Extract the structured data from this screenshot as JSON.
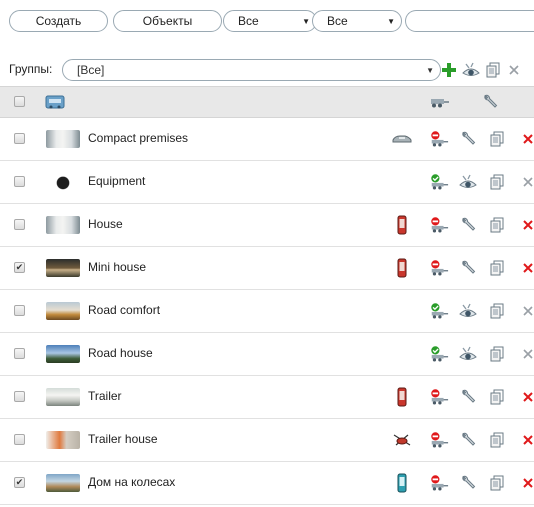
{
  "toolbar": {
    "create_label": "Создать",
    "objects_label": "Объекты",
    "filter1_value": "Все",
    "filter2_value": "Все",
    "search_value": ""
  },
  "groups": {
    "label": "Группы:",
    "selected": "[Все]"
  },
  "rows": [
    {
      "name": "Compact premises",
      "checked": false,
      "device": "car-icon",
      "status": "red",
      "action": "wrench-icon",
      "deletable": true
    },
    {
      "name": "Equipment",
      "checked": false,
      "device": "",
      "status": "green",
      "action": "eye-icon",
      "deletable": false
    },
    {
      "name": "House",
      "checked": false,
      "device": "phone-red-icon",
      "status": "red",
      "action": "wrench-icon",
      "deletable": true
    },
    {
      "name": "Mini house",
      "checked": true,
      "device": "phone-red-icon",
      "status": "red",
      "action": "wrench-icon",
      "deletable": true
    },
    {
      "name": "Road comfort",
      "checked": false,
      "device": "",
      "status": "green",
      "action": "eye-icon",
      "deletable": false
    },
    {
      "name": "Road house",
      "checked": false,
      "device": "",
      "status": "green",
      "action": "eye-icon",
      "deletable": false
    },
    {
      "name": "Trailer",
      "checked": false,
      "device": "phone-red-icon",
      "status": "red",
      "action": "wrench-icon",
      "deletable": true
    },
    {
      "name": "Trailer house",
      "checked": false,
      "device": "helicopter-icon",
      "status": "red",
      "action": "wrench-icon",
      "deletable": true
    },
    {
      "name": "Дом на колесах",
      "checked": true,
      "device": "phone-teal-icon",
      "status": "red",
      "action": "wrench-icon",
      "deletable": true
    }
  ],
  "colors": {
    "accent_green": "#2a9d2a",
    "delete_red": "#e0191b",
    "header_bg": "#e8e8e8",
    "border": "#9aa9b3"
  }
}
